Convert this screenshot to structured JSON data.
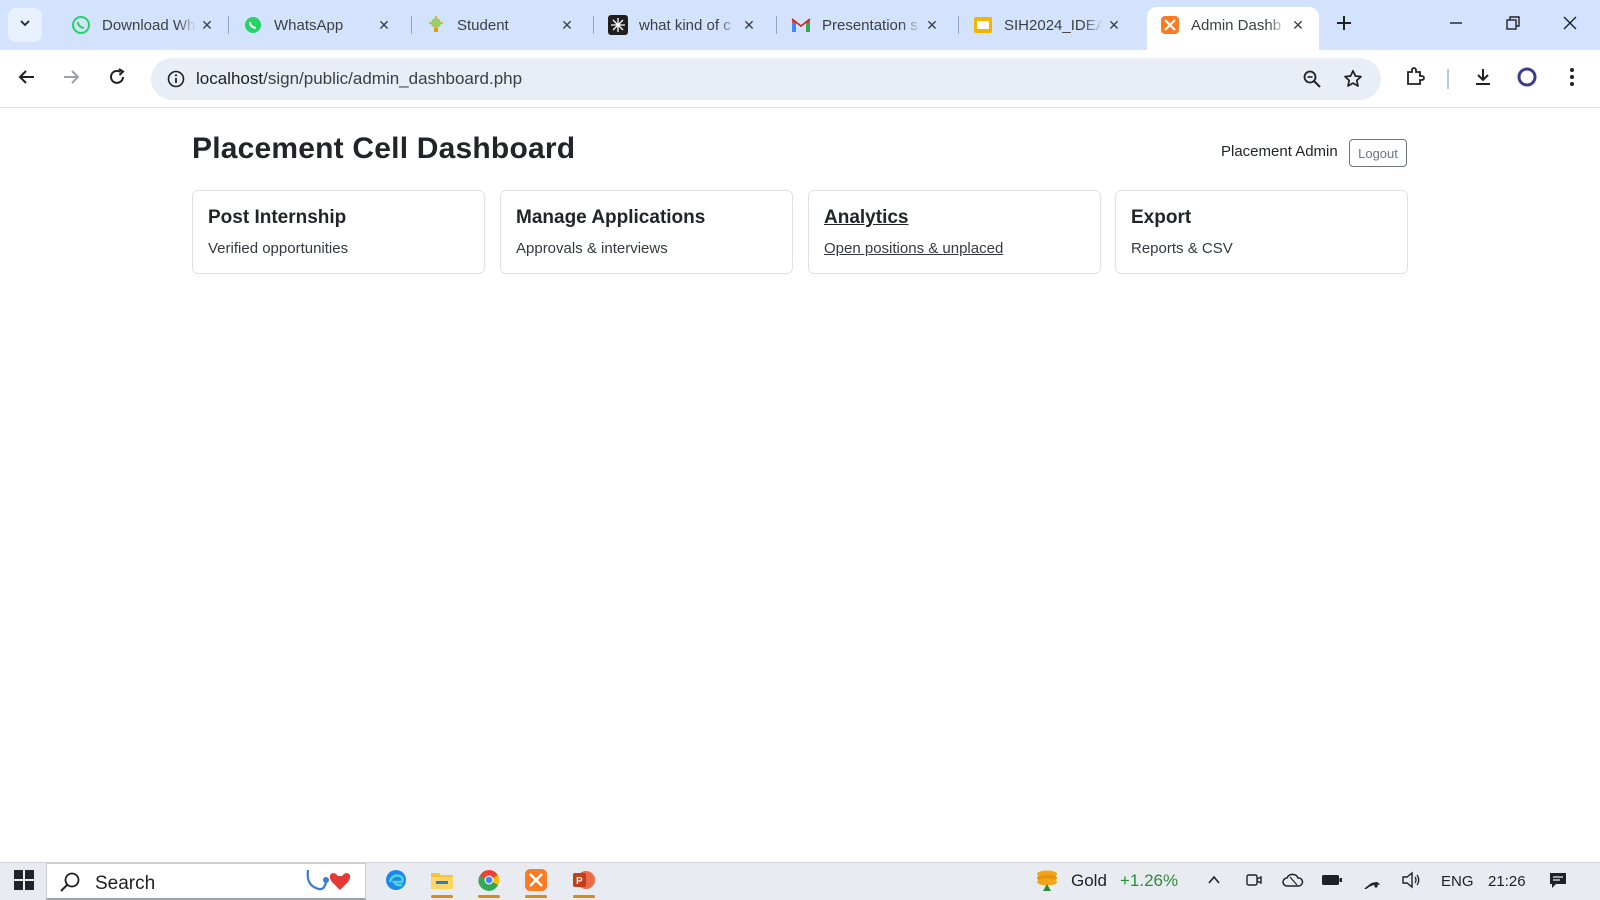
{
  "browser": {
    "tabs": [
      {
        "title": "Download Wh",
        "icon": "whatsapp-icon"
      },
      {
        "title": "WhatsApp",
        "icon": "whatsapp-icon"
      },
      {
        "title": "Student",
        "icon": "lightbulb-icon"
      },
      {
        "title": "what kind of c",
        "icon": "chatgpt-icon"
      },
      {
        "title": "Presentation s",
        "icon": "gmail-icon"
      },
      {
        "title": "SIH2024_IDEA",
        "icon": "slides-icon"
      },
      {
        "title": "Admin Dashb",
        "icon": "xampp-icon",
        "active": true
      }
    ],
    "address": {
      "host": "localhost",
      "path": "/sign/public/admin_dashboard.php"
    }
  },
  "page": {
    "title": "Placement Cell Dashboard",
    "user": "Placement Admin",
    "logout_label": "Logout",
    "cards": [
      {
        "title": "Post Internship",
        "subtitle": "Verified opportunities"
      },
      {
        "title": "Manage Applications",
        "subtitle": "Approvals & interviews"
      },
      {
        "title": "Analytics",
        "subtitle": "Open positions & unplaced",
        "hovered": true
      },
      {
        "title": "Export",
        "subtitle": "Reports & CSV"
      }
    ]
  },
  "taskbar": {
    "search_label": "Search",
    "widget_label": "Gold",
    "widget_change": "+1.26%",
    "language": "ENG",
    "time": "21:26"
  },
  "colors": {
    "tabstrip": "#d3e3fd",
    "omnibox": "#e9eef6",
    "positive": "#2e8b3a",
    "xampp": "#fb7a24"
  }
}
